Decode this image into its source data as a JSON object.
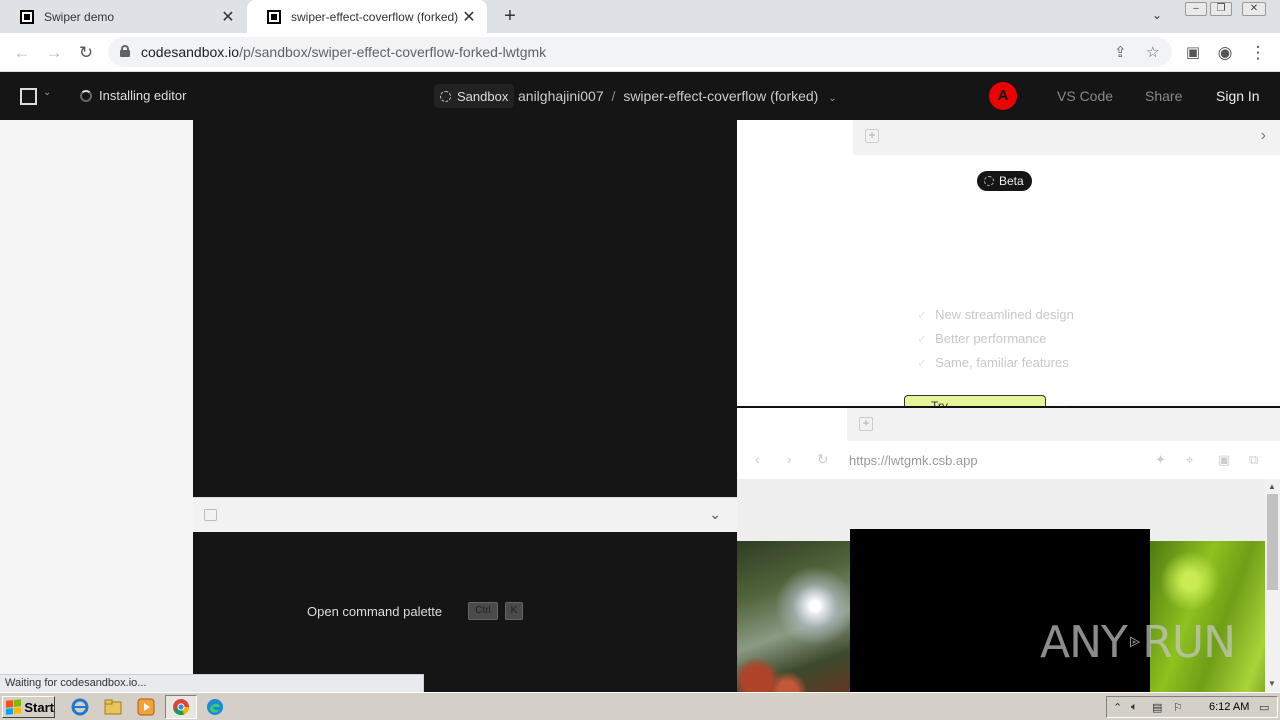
{
  "browser": {
    "tabs": [
      {
        "title": "Swiper demo",
        "active": false
      },
      {
        "title": "swiper-effect-coverflow (forked) - C",
        "active": true
      }
    ],
    "new_tab_label": "+",
    "url_host": "codesandbox.io",
    "url_rest": "/p/sandbox/swiper-effect-coverflow-forked-lwtgmk",
    "status_text": "Waiting for codesandbox.io..."
  },
  "csb": {
    "installing_label": "Installing editor",
    "sandbox_label": "Sandbox",
    "owner": "anilghajini007",
    "separator": "/",
    "project_name": "swiper-effect-coverflow (forked)",
    "avatar_letter": "A",
    "vscode_label": "VS Code",
    "share_label": "Share",
    "signin_label": "Sign In"
  },
  "terminal": {
    "command_palette_label": "Open command palette",
    "key1": "Ctrl",
    "key2": "K"
  },
  "beta_panel": {
    "badge": "Beta",
    "features": [
      "New streamlined design",
      "Better performance",
      "Same, familiar features"
    ],
    "try_label": "Try ..."
  },
  "preview": {
    "url": "https://lwtgmk.csb.app"
  },
  "watermark": {
    "left": "ANY",
    "right": "RUN"
  },
  "taskbar": {
    "start_label": "Start",
    "clock": "6:12 AM"
  },
  "colors": {
    "csb_dark": "#151515",
    "avatar_red": "#e00000",
    "try_button_bg": "#e7f59a"
  }
}
